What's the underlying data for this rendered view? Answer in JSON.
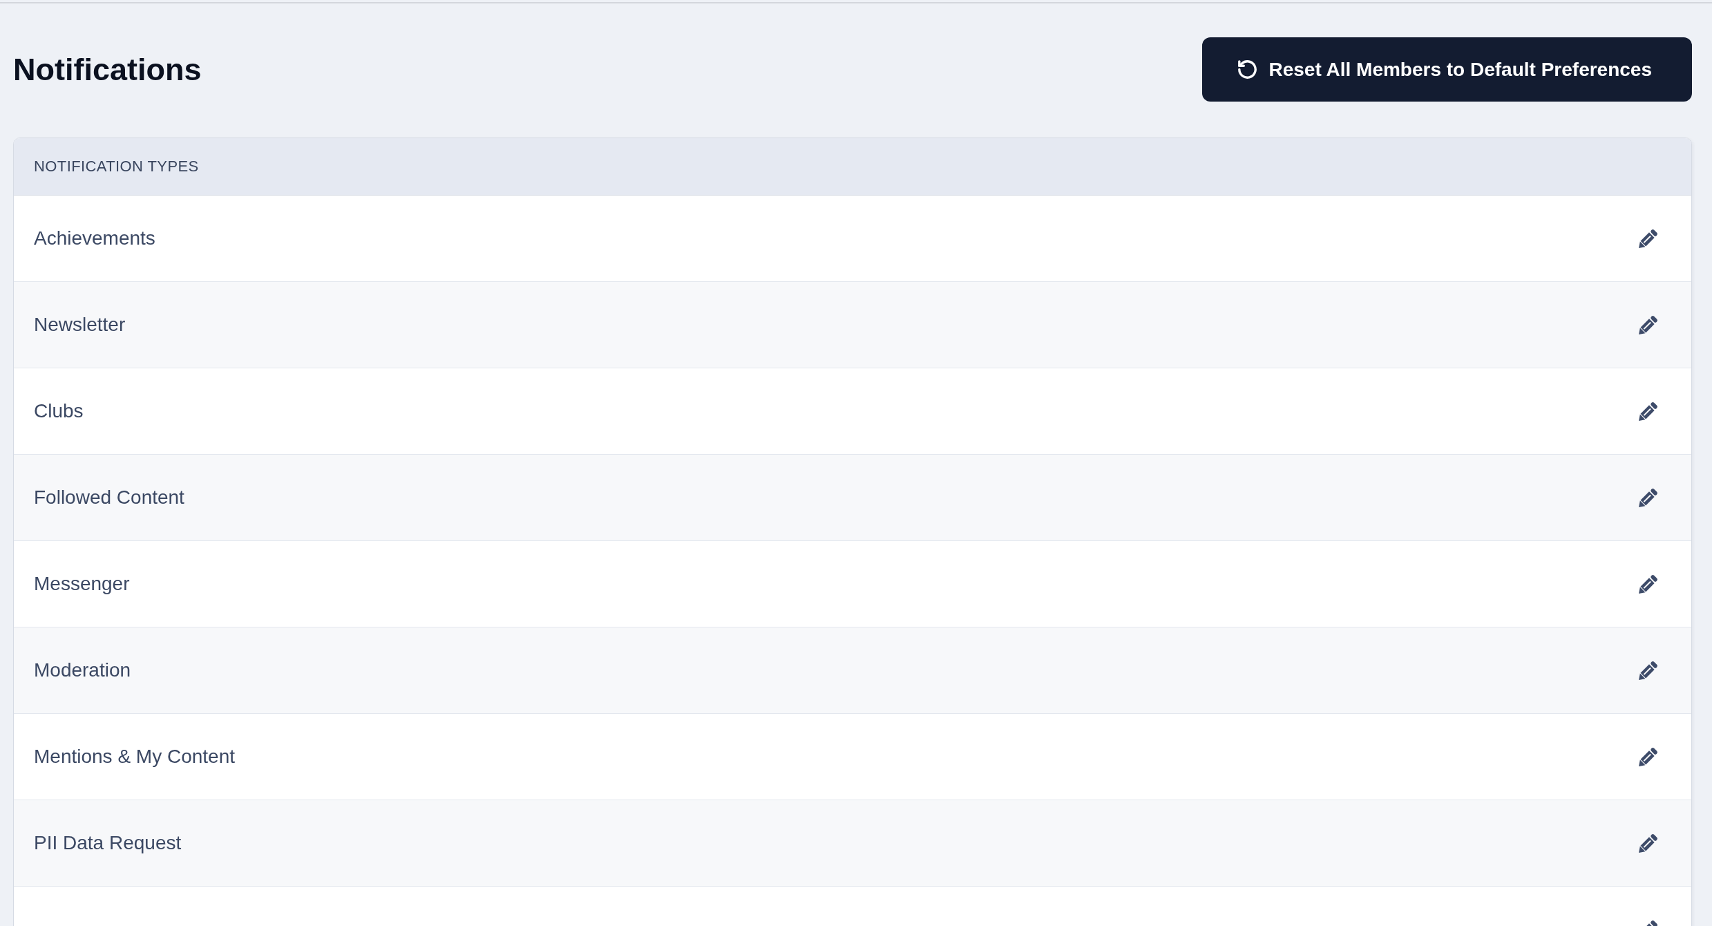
{
  "page_title": "Notifications",
  "reset_button": {
    "label": "Reset All Members to Default Preferences"
  },
  "notification_types": {
    "heading": "NOTIFICATION TYPES",
    "rows": [
      {
        "label": "Achievements"
      },
      {
        "label": "Newsletter"
      },
      {
        "label": "Clubs"
      },
      {
        "label": "Followed Content"
      },
      {
        "label": "Messenger"
      },
      {
        "label": "Moderation"
      },
      {
        "label": "Mentions & My Content"
      },
      {
        "label": "PII Data Request"
      },
      {}
    ]
  }
}
